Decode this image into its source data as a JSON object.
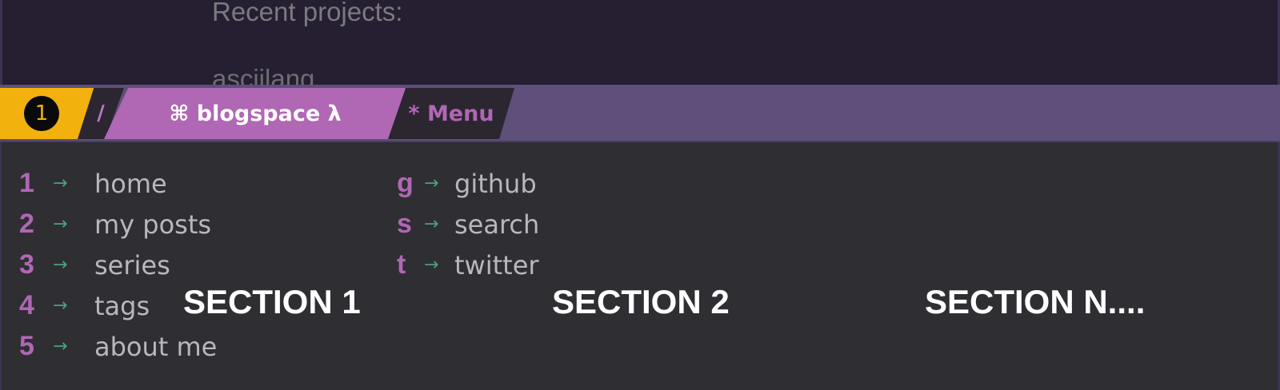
{
  "editor": {
    "recent_projects_label": "Recent projects:",
    "recent_project_item": "asciilang"
  },
  "modeline": {
    "window_number": "1",
    "slash": "/",
    "buffer_name": "⌘ blogspace λ",
    "menu_label": "* Menu"
  },
  "menu": {
    "column1": [
      {
        "key": "1",
        "arrow": "→",
        "label": "home"
      },
      {
        "key": "2",
        "arrow": "→",
        "label": "my posts"
      },
      {
        "key": "3",
        "arrow": "→",
        "label": "series"
      },
      {
        "key": "4",
        "arrow": "→",
        "label": "tags"
      },
      {
        "key": "5",
        "arrow": "→",
        "label": "about me"
      }
    ],
    "column2": [
      {
        "key": "g",
        "arrow": "→",
        "label": "github"
      },
      {
        "key": "s",
        "arrow": "→",
        "label": "search"
      },
      {
        "key": "t",
        "arrow": "→",
        "label": "twitter"
      }
    ]
  },
  "annotations": {
    "section_1": "SECTION 1",
    "section_2": "SECTION 2",
    "section_n": "SECTION N...."
  },
  "colors": {
    "modeline_bg": "#5e4f7b",
    "number_segment": "#f2b10d",
    "buffer_segment": "#b067b4",
    "key_color": "#b067b4",
    "arrow_color": "#4aa37a",
    "label_color": "#b8b8bc"
  }
}
